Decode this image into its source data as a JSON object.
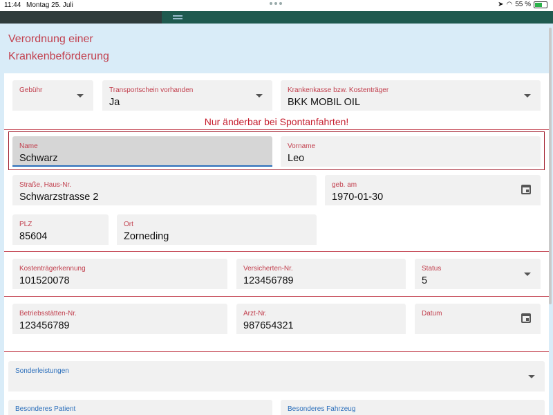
{
  "statusbar": {
    "time": "11:44",
    "date": "Montag 25. Juli",
    "battery": "55 %"
  },
  "header": {
    "title_line1": "Verordnung einer",
    "title_line2": "Krankenbeförderung"
  },
  "row1": {
    "gebuehr": {
      "label": "Gebühr",
      "value": ""
    },
    "transportschein": {
      "label": "Transportschein vorhanden",
      "value": "Ja"
    },
    "krankenkasse": {
      "label": "Krankenkasse bzw. Kostenträger",
      "value": "BKK MOBIL OIL"
    }
  },
  "notice": "Nur änderbar bei Spontanfahrten!",
  "patient": {
    "name": {
      "label": "Name",
      "value": "Schwarz"
    },
    "vorname": {
      "label": "Vorname",
      "value": "Leo"
    },
    "strasse": {
      "label": "Straße, Haus-Nr.",
      "value": "Schwarzstrasse 2"
    },
    "geburt": {
      "label": "geb. am",
      "value": "1970-01-30"
    },
    "plz": {
      "label": "PLZ",
      "value": "85604"
    },
    "ort": {
      "label": "Ort",
      "value": "Zorneding"
    }
  },
  "insurance": {
    "kennung": {
      "label": "Kostenträgerkennung",
      "value": "101520078"
    },
    "versicherten": {
      "label": "Versicherten-Nr.",
      "value": "123456789"
    },
    "status": {
      "label": "Status",
      "value": "5"
    }
  },
  "doctor": {
    "betrieb": {
      "label": "Betriebsstätten-Nr.",
      "value": "123456789"
    },
    "arzt": {
      "label": "Arzt-Nr.",
      "value": "987654321"
    },
    "datum": {
      "label": "Datum",
      "value": ""
    }
  },
  "extras": {
    "sonder": {
      "label": "Sonderleistungen",
      "value": ""
    },
    "patient": {
      "label": "Besonderes Patient",
      "value": ""
    },
    "fahrzeug": {
      "label": "Besonderes Fahrzeug",
      "value": ""
    }
  }
}
